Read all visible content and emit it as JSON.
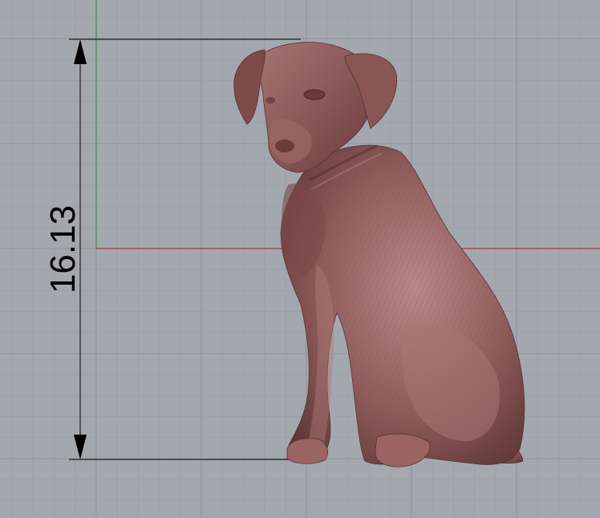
{
  "viewport": {
    "background": "#a3a8ae",
    "grid_minor_color": "#98a0a6",
    "grid_major_color": "#8c949a",
    "x_axis_color": "#c0302a",
    "y_axis_color": "#3a9a3a"
  },
  "dimension": {
    "value": "16.13",
    "orientation": "vertical",
    "line_color": "#000000"
  },
  "model": {
    "subject": "sitting-dog-relief",
    "color": "#8e5a5a",
    "highlight": "#b58585",
    "shadow": "#5e3535"
  }
}
